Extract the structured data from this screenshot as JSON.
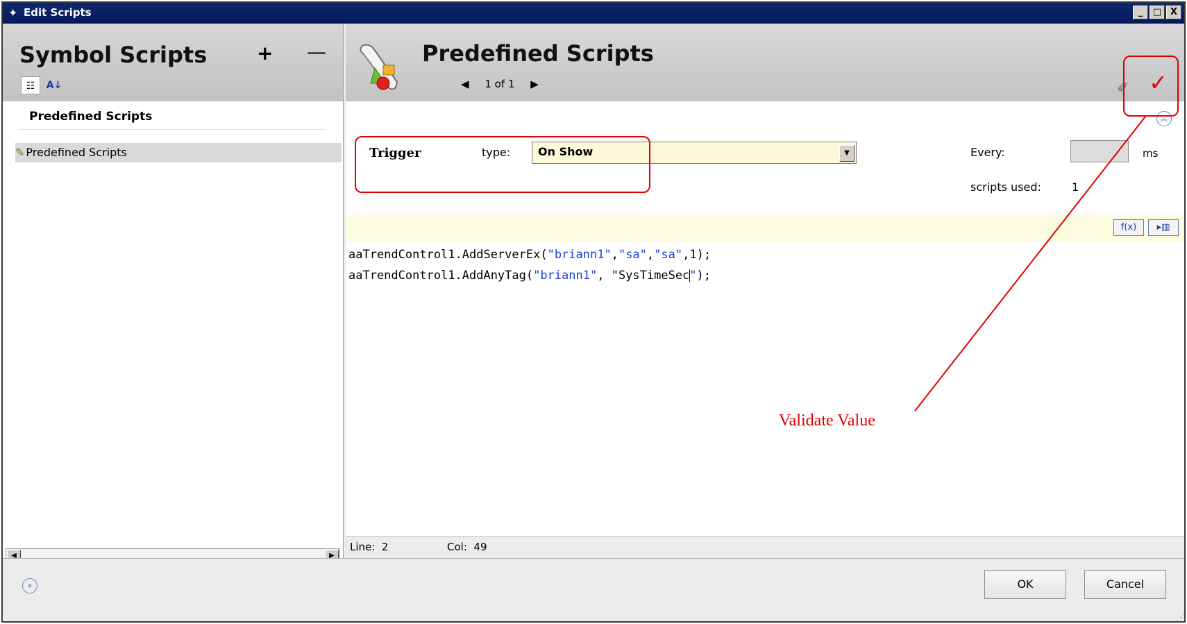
{
  "window": {
    "title": "Edit Scripts",
    "icon": "script-app-icon",
    "controls": [
      "_",
      "□",
      "X"
    ]
  },
  "left": {
    "title": "Symbol Scripts",
    "add_label": "+",
    "remove_label": "—",
    "section_label": "Predefined Scripts",
    "tree_items": [
      {
        "label": "Predefined Scripts",
        "icon": "scripts-tree-icon"
      }
    ]
  },
  "right": {
    "title": "Predefined Scripts",
    "pager": {
      "prev": "◀",
      "text": "1 of 1",
      "next": "▶"
    },
    "trigger": {
      "label": "Trigger",
      "type_label": "type:",
      "type_value": "On Show",
      "every_label": "Every:",
      "every_value": "",
      "ms_label": "ms",
      "scripts_used_label": "scripts used:",
      "scripts_used_value": "1"
    },
    "editor_buttons": [
      {
        "label": "f(x)",
        "icon": "function-icon"
      },
      {
        "label": "▸▥",
        "icon": "insert-icon"
      }
    ],
    "code_lines": [
      "aaTrendControl1.AddServerEx(\"briann1\",\"sa\",\"sa\",1);",
      "aaTrendControl1.AddAnyTag(\"briann1\", \"SysTimeSec\");"
    ],
    "status": {
      "line_label": "Line:",
      "line_value": "2",
      "col_label": "Col:",
      "col_value": "49"
    }
  },
  "buttons": {
    "ok": "OK",
    "cancel": "Cancel"
  },
  "annotation": {
    "text": "Validate Value",
    "color": "#e00000"
  }
}
